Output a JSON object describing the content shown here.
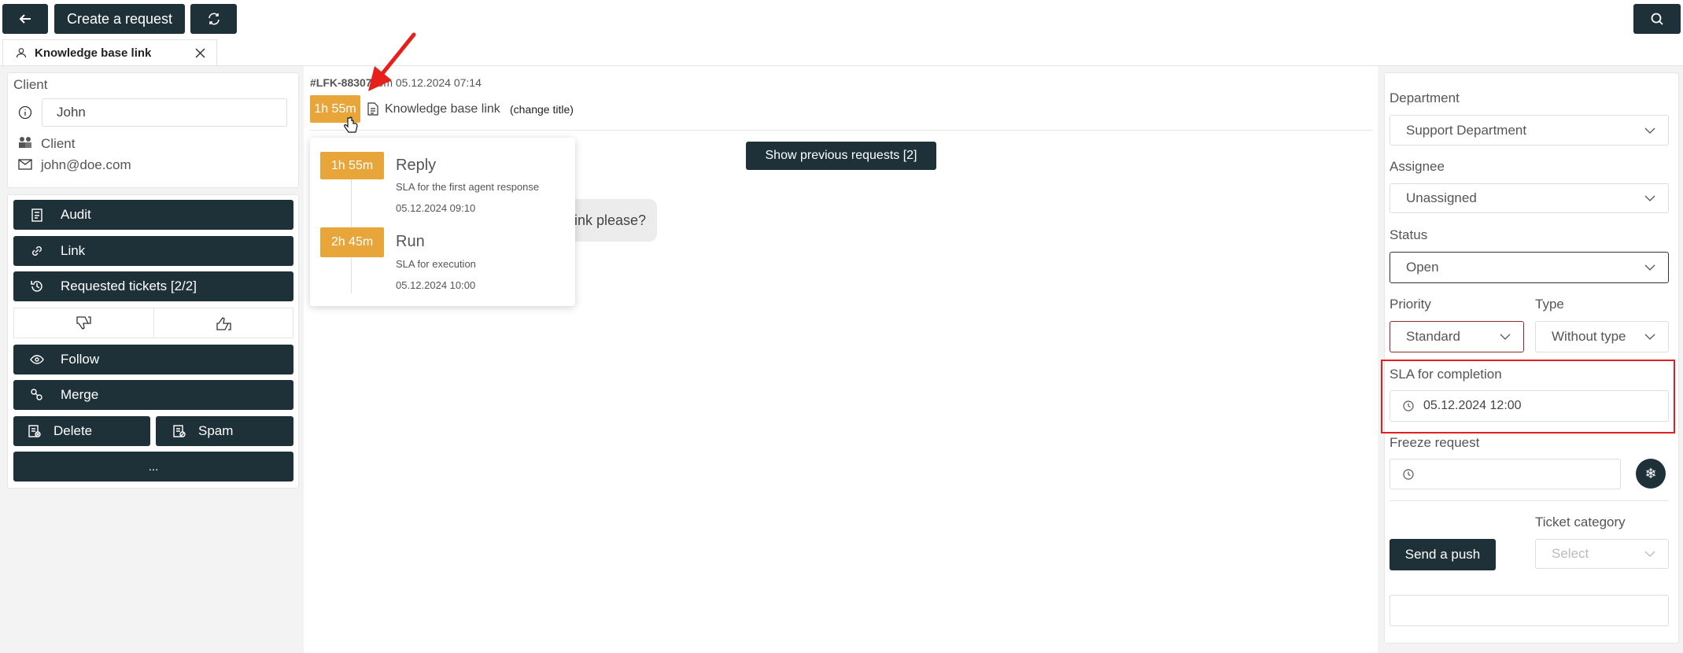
{
  "topbar": {
    "back_icon": "arrow-left-icon",
    "create_label": "Create a request",
    "refresh_icon": "refresh-icon",
    "search_icon": "search-icon"
  },
  "tab": {
    "label": "Knowledge base link",
    "icon": "user-icon",
    "close_icon": "close-icon"
  },
  "client": {
    "heading": "Client",
    "name": "John",
    "role": "Client",
    "email": "john@doe.com"
  },
  "actions": {
    "audit": "Audit",
    "link": "Link",
    "requested": "Requested tickets [2/2]",
    "follow": "Follow",
    "merge": "Merge",
    "delete": "Delete",
    "spam": "Spam",
    "more": "..."
  },
  "ticket": {
    "id": "#LFK-88307",
    "from_text": "from 05.12.2024 07:14",
    "sla_badge": "1h 55m",
    "title": "Knowledge base link",
    "change_title": "(change title)",
    "show_previous": "Show previous requests [2]",
    "message_fragment": "ink please?"
  },
  "sla_popup": {
    "items": [
      {
        "time": "1h 55m",
        "name": "Reply",
        "desc": "SLA for the first agent response",
        "date": "05.12.2024 09:10"
      },
      {
        "time": "2h 45m",
        "name": "Run",
        "desc": "SLA for execution",
        "date": "05.12.2024 10:00"
      }
    ]
  },
  "form": {
    "department_label": "Department",
    "department_value": "Support Department",
    "assignee_label": "Assignee",
    "assignee_value": "Unassigned",
    "status_label": "Status",
    "status_value": "Open",
    "priority_label": "Priority",
    "priority_value": "Standard",
    "type_label": "Type",
    "type_value": "Without type",
    "sla_label": "SLA for completion",
    "sla_value": "05.12.2024 12:00",
    "freeze_label": "Freeze request",
    "freeze_value": "",
    "category_label": "Ticket category",
    "category_placeholder": "Select",
    "push_label": "Send a push",
    "bottom_value": ""
  },
  "colors": {
    "dark": "#1f3138",
    "sla_orange": "#e7a53a",
    "highlight_red": "#e02020"
  }
}
